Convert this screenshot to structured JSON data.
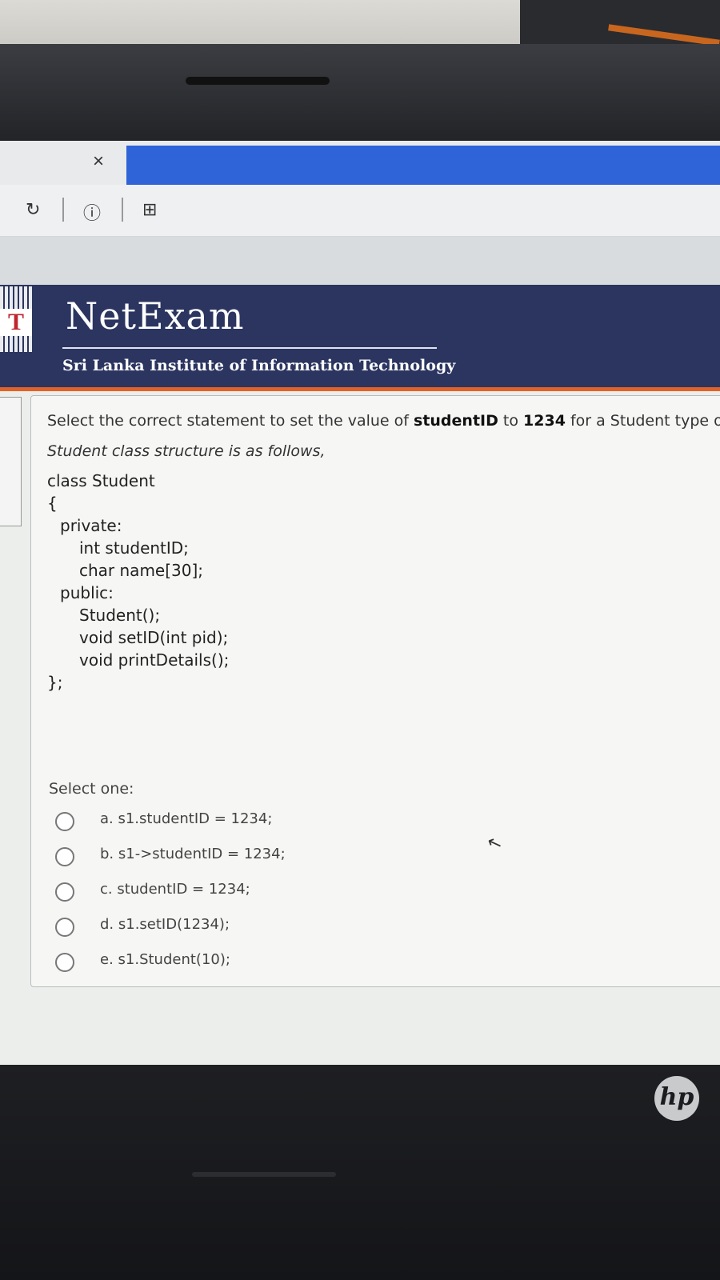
{
  "browser": {
    "close_glyph": "×",
    "reload_glyph": "↻",
    "info_glyph": "ⓘ",
    "new_tab_glyph": "⊞"
  },
  "site": {
    "title": "NetExam",
    "subtitle": "Sri Lanka Institute of Information Technology",
    "logo_letter": "T"
  },
  "question": {
    "prefix": "Select the correct statement to set the value of ",
    "field": "studentID",
    "middle": " to ",
    "value": "1234",
    "suffix": " for a Student type ob",
    "note": "Student class structure is as follows,",
    "code_lines": [
      "class Student",
      "{",
      "private:",
      "int studentID;",
      "char name[30];",
      "public:",
      "Student();",
      "void setID(int pid);",
      "void printDetails();",
      "};"
    ],
    "select_one": "Select one:",
    "options": [
      "a. s1.studentID = 1234;",
      "b. s1->studentID = 1234;",
      "c. studentID = 1234;",
      "d. s1.setID(1234);",
      "e. s1.Student(10);"
    ]
  },
  "device": {
    "brand": "hp"
  }
}
